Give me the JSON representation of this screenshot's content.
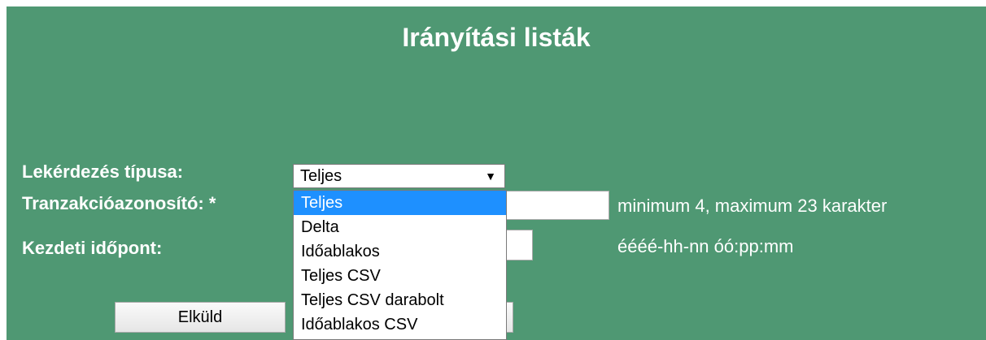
{
  "page": {
    "title": "Irányítási listák"
  },
  "form": {
    "query_type": {
      "label": "Lekérdezés típusa:",
      "selected": "Teljes",
      "options": [
        "Teljes",
        "Delta",
        "Időablakos",
        "Teljes CSV",
        "Teljes CSV darabolt",
        "Időablakos CSV"
      ]
    },
    "transaction_id": {
      "label": "Tranzakcióazonosító: *",
      "value": "",
      "hint": "minimum 4, maximum 23 karakter"
    },
    "start_time": {
      "label": "Kezdeti időpont:",
      "value": "",
      "hint": "éééé-hh-nn óó:pp:mm"
    },
    "submit_label": "Elküld"
  },
  "icons": {
    "select_arrow": "caret-down-icon"
  },
  "colors": {
    "panel_bg": "#4f9873",
    "selected_option": "#1e90ff"
  }
}
